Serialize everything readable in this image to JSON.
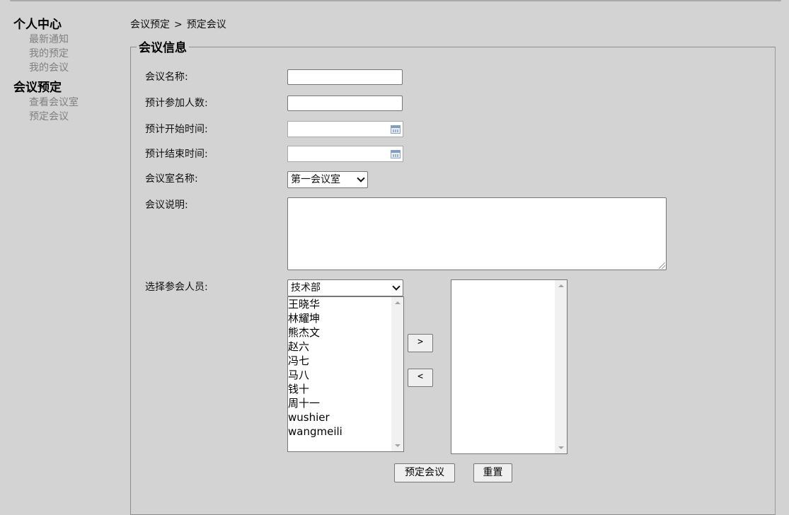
{
  "sidebar": {
    "groups": [
      {
        "title": "个人中心",
        "items": [
          "最新通知",
          "我的预定",
          "我的会议"
        ]
      },
      {
        "title": "会议预定",
        "items": [
          "查看会议室",
          "预定会议"
        ]
      }
    ]
  },
  "breadcrumb": {
    "parent": "会议预定",
    "separator": ">",
    "current": "预定会议"
  },
  "form": {
    "legend": "会议信息",
    "meeting_name": {
      "label": "会议名称:",
      "value": ""
    },
    "expected_attendees": {
      "label": "预计参加人数:",
      "value": ""
    },
    "start_time": {
      "label": "预计开始时间:",
      "value": "",
      "icon": "calendar-icon"
    },
    "end_time": {
      "label": "预计结束时间:",
      "value": "",
      "icon": "calendar-icon"
    },
    "room": {
      "label": "会议室名称:",
      "selected": "第一会议室"
    },
    "description": {
      "label": "会议说明:",
      "value": ""
    },
    "participants": {
      "label": "选择参会人员:",
      "department_selected": "技术部",
      "available": [
        "王晓华",
        "林耀坤",
        "熊杰文",
        "赵六",
        "冯七",
        "马八",
        "钱十",
        "周十一",
        "wushier",
        "wangmeili"
      ],
      "selected": [],
      "add_button": ">",
      "remove_button": "<"
    },
    "submit_label": "预定会议",
    "reset_label": "重置"
  }
}
